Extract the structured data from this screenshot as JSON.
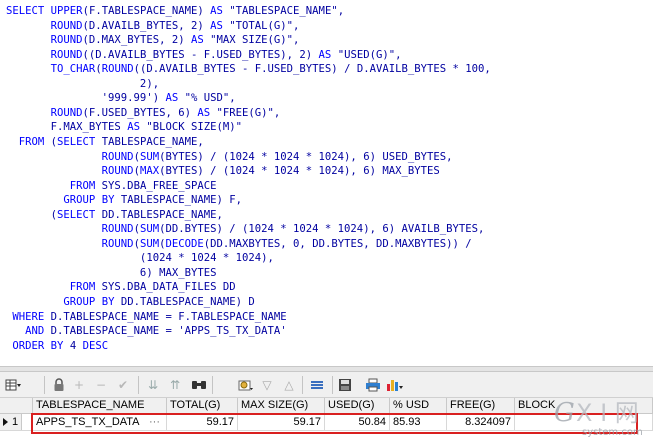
{
  "sql": {
    "lines": [
      "SELECT UPPER(F.TABLESPACE_NAME) AS \"TABLESPACE_NAME\",",
      "       ROUND(D.AVAILB_BYTES, 2) AS \"TOTAL(G)\",",
      "       ROUND(D.MAX_BYTES, 2) AS \"MAX SIZE(G)\",",
      "       ROUND((D.AVAILB_BYTES - F.USED_BYTES), 2) AS \"USED(G)\",",
      "       TO_CHAR(ROUND((D.AVAILB_BYTES - F.USED_BYTES) / D.AVAILB_BYTES * 100,",
      "                     2),",
      "               '999.99') AS \"% USD\",",
      "       ROUND(F.USED_BYTES, 6) AS \"FREE(G)\",",
      "       F.MAX_BYTES AS \"BLOCK SIZE(M)\"",
      "  FROM (SELECT TABLESPACE_NAME,",
      "               ROUND(SUM(BYTES) / (1024 * 1024 * 1024), 6) USED_BYTES,",
      "               ROUND(MAX(BYTES) / (1024 * 1024 * 1024), 6) MAX_BYTES",
      "          FROM SYS.DBA_FREE_SPACE",
      "         GROUP BY TABLESPACE_NAME) F,",
      "       (SELECT DD.TABLESPACE_NAME,",
      "               ROUND(SUM(DD.BYTES) / (1024 * 1024 * 1024), 6) AVAILB_BYTES,",
      "               ROUND(SUM(DECODE(DD.MAXBYTES, 0, DD.BYTES, DD.MAXBYTES)) /",
      "                     (1024 * 1024 * 1024),",
      "                     6) MAX_BYTES",
      "          FROM SYS.DBA_DATA_FILES DD",
      "         GROUP BY DD.TABLESPACE_NAME) D",
      " WHERE D.TABLESPACE_NAME = F.TABLESPACE_NAME",
      "   AND D.TABLESPACE_NAME = 'APPS_TS_TX_DATA'",
      " ORDER BY 4 DESC"
    ]
  },
  "grid": {
    "columns": [
      "TABLESPACE_NAME",
      "TOTAL(G)",
      "MAX SIZE(G)",
      "USED(G)",
      "% USD",
      "FREE(G)",
      "BLOCK"
    ],
    "row_number": "1",
    "rows": [
      [
        "APPS_TS_TX_DATA",
        "59.17",
        "59.17",
        "50.84",
        "85.93",
        "8.324097",
        ""
      ]
    ],
    "ellipsis": "···"
  },
  "colors": {
    "keyword": "#0000ff",
    "code": "#0000a0",
    "highlight_border": "#d92020"
  },
  "icons": [
    "grid-menu-icon",
    "lock-icon",
    "add-row-icon",
    "delete-row-icon",
    "post-icon",
    "first-icon",
    "last-icon",
    "find-icon",
    "filter-icon",
    "sort-asc-icon",
    "sort-desc-icon",
    "export-icon",
    "save-icon",
    "print-icon",
    "chart-icon"
  ],
  "watermark": {
    "brand": "GXI网",
    "site": "system.com"
  }
}
